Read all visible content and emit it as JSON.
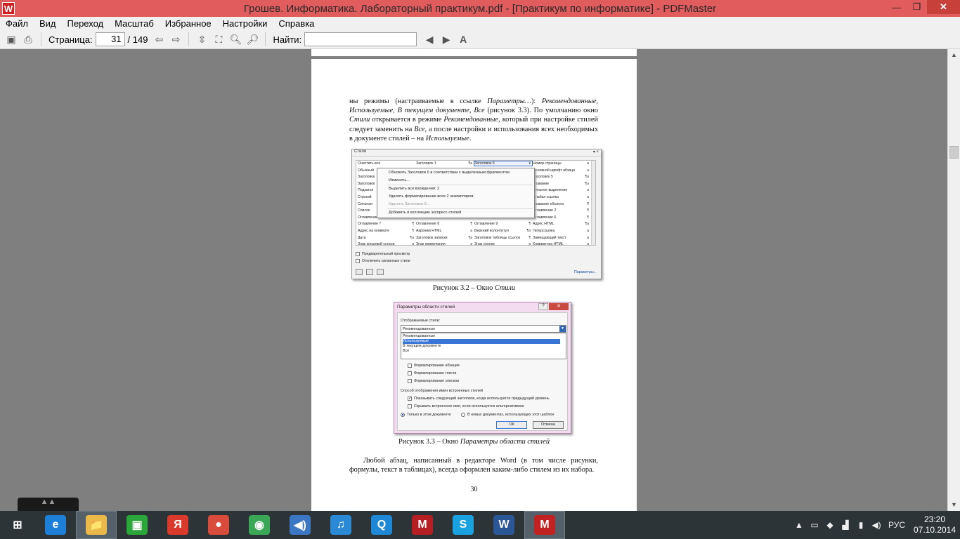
{
  "window": {
    "app_icon": "W",
    "title": "Грошев. Информатика. Лабораторный практикум.pdf - [Практикум по информатике] - PDFMaster"
  },
  "menu": [
    "Файл",
    "Вид",
    "Переход",
    "Масштаб",
    "Избранное",
    "Настройки",
    "Справка"
  ],
  "toolbar": {
    "page_label": "Страница:",
    "page_value": "31",
    "page_total": "/ 149",
    "find_label": "Найти:",
    "find_value": ""
  },
  "document": {
    "para1_html": "ны режимы (настраиваемые в ссылке <i>Параметры…</i>): <i>Рекомендованные, Используемые, В текущем документе, Все</i> (рисунок 3.3). По умолчанию окно <i>Стили</i> открывается в режиме <i>Рекомендованные</i>, который при настройке стилей следует заменить на <i>Все</i>, а после настройки и использования всех необходимых в документе стилей – на <i>Используемые</i>.",
    "fig1": {
      "title": "Стили",
      "close": "▾ ×",
      "grid": [
        [
          [
            "Очистить все",
            ""
          ],
          [
            "Заголовок 1",
            "¶a"
          ],
          [
            "Заголовок 6",
            "▾"
          ],
          [
            "Номер страницы",
            "a"
          ]
        ],
        [
          [
            "Обычный",
            ""
          ],
          [
            "",
            ""
          ],
          [
            "",
            ""
          ],
          [
            "Основной шрифт абзаца",
            "a"
          ]
        ],
        [
          [
            "Заголовок",
            ""
          ],
          [
            "",
            ""
          ],
          [
            "",
            ""
          ],
          [
            "Заголовок 5",
            "¶a"
          ]
        ],
        [
          [
            "Заголовок",
            ""
          ],
          [
            "",
            ""
          ],
          [
            "",
            ""
          ],
          [
            "Название",
            "¶a"
          ]
        ],
        [
          [
            "Подзагол",
            ""
          ],
          [
            "",
            ""
          ],
          [
            "",
            ""
          ],
          [
            "Сильное выделение",
            "a"
          ]
        ],
        [
          [
            "Строгий",
            ""
          ],
          [
            "",
            ""
          ],
          [
            "",
            ""
          ],
          [
            "Слабая ссылка",
            "a"
          ]
        ],
        [
          [
            "Сильная",
            ""
          ],
          [
            "",
            ""
          ],
          [
            "",
            ""
          ],
          [
            "Название объекта",
            "¶"
          ]
        ],
        [
          [
            "Список",
            ""
          ],
          [
            "",
            ""
          ],
          [
            "",
            ""
          ],
          [
            "Оглавление 2",
            "¶"
          ]
        ],
        [
          [
            "Оглавление 3",
            "¶"
          ],
          [
            "Оглавление 4",
            "¶"
          ],
          [
            "Оглавление 5",
            "¶"
          ],
          [
            "Оглавление 6",
            "¶"
          ]
        ],
        [
          [
            "Оглавление 7",
            "¶"
          ],
          [
            "Оглавление 8",
            "¶"
          ],
          [
            "Оглавление 9",
            "¶"
          ],
          [
            "Адрес HTML",
            "¶a"
          ]
        ],
        [
          [
            "Адрес на конверте",
            "¶"
          ],
          [
            "Акроним HTML",
            "a"
          ],
          [
            "Верхний колонтитул",
            "¶a"
          ],
          [
            "Гиперссылка",
            "a"
          ]
        ],
        [
          [
            "Дата",
            "¶a"
          ],
          [
            "Заголовок записки",
            "¶a"
          ],
          [
            "Заголовок таблицы ссылок",
            "¶"
          ],
          [
            "Замещающий текст",
            "a"
          ]
        ],
        [
          [
            "Знак концевой сноски",
            "a"
          ],
          [
            "Знак примечания",
            "a"
          ],
          [
            "Знак сноски",
            "a"
          ],
          [
            "Клавиатура HTML",
            "a"
          ]
        ]
      ],
      "menu": [
        "Обновить Заголовок 6 в соответствии с выделенным фрагментом",
        "Изменить...",
        "Выделить все вхождения: 2",
        "Удалить форматирование всех 2 экземпляров",
        "Удалить Заголовок 6...",
        "Добавить в коллекцию экспресс-стилей"
      ],
      "check1": "Предварительный просмотр",
      "check2": "Отключить связанные стили",
      "link": "Параметры..."
    },
    "caption1_html": "Рисунок 3.2 – Окно <i>Стили</i>",
    "fig2": {
      "title": "Параметры области стилей",
      "help": "?",
      "close": "✕",
      "label_show": "Отображаемые стили:",
      "selected": "Рекомендованные",
      "list": [
        "Рекомендованные",
        "Используемые",
        "В текущем документе",
        "Все"
      ],
      "opt1": "Форматирование абзацев",
      "opt2": "Форматирование текста",
      "opt3": "Форматирование списков",
      "section2": "Способ отображения имен встроенных стилей",
      "opt4": "Показывать следующий заголовок, когда используется предыдущий уровень",
      "opt5": "Скрывать встроенное имя, если используется альтернативное",
      "radio1": "Только в этом документе",
      "radio2": "В новых документах, использующих этот шаблон",
      "ok": "ОК",
      "cancel": "Отмена"
    },
    "caption2_html": "Рисунок 3.3 – Окно <i>Параметры области стилей</i>",
    "para2": "Любой абзац, написанный в редакторе Word (в том числе рисунки, формулы, текст в таблицах), всегда оформлен каким-либо стилем из их набора.",
    "page_number": "30"
  },
  "taskbar": {
    "apps": [
      {
        "name": "start",
        "glyph": "⊞",
        "color": "#2c3438"
      },
      {
        "name": "internet-explorer",
        "glyph": "e",
        "color": "#1e7fd8"
      },
      {
        "name": "file-explorer",
        "glyph": "📁",
        "color": "#e9b949"
      },
      {
        "name": "store",
        "glyph": "▣",
        "color": "#2aa63a"
      },
      {
        "name": "yandex-browser",
        "glyph": "Я",
        "color": "#d93a2b"
      },
      {
        "name": "picasa",
        "glyph": "●",
        "color": "#d94b3b"
      },
      {
        "name": "chrome",
        "glyph": "◉",
        "color": "#3aa757"
      },
      {
        "name": "sound-app",
        "glyph": "◀)",
        "color": "#3b77c2"
      },
      {
        "name": "itunes",
        "glyph": "♫",
        "color": "#2a8ad6"
      },
      {
        "name": "quicktime",
        "glyph": "Q",
        "color": "#1f88d6"
      },
      {
        "name": "mcafee",
        "glyph": "M",
        "color": "#b51f24"
      },
      {
        "name": "skype",
        "glyph": "S",
        "color": "#1aa2e0"
      },
      {
        "name": "word",
        "glyph": "W",
        "color": "#2b5797"
      },
      {
        "name": "pdfmaster",
        "glyph": "M",
        "color": "#c22222"
      }
    ],
    "tray_lang": "РУС",
    "time": "23:20",
    "date": "07.10.2014"
  }
}
